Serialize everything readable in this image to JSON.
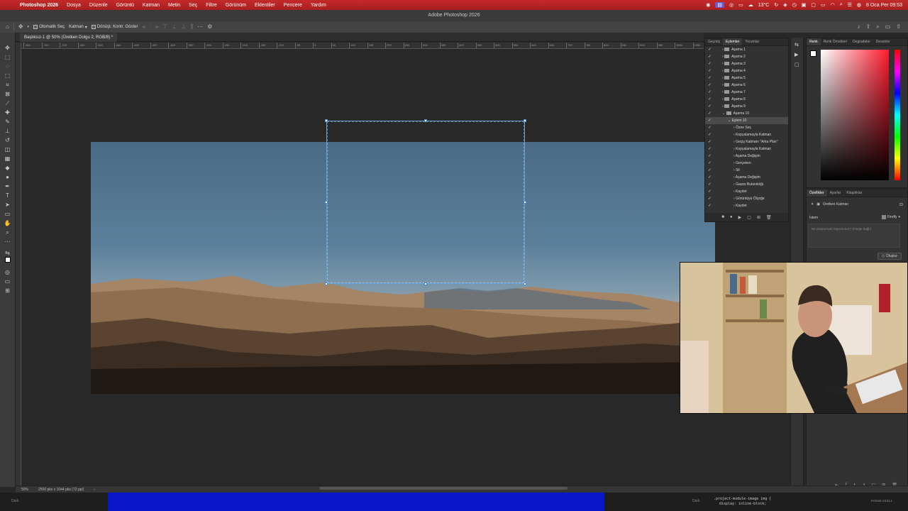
{
  "menubar": {
    "items": [
      "Photoshop 2026",
      "Dosya",
      "Düzenle",
      "Görüntü",
      "Katman",
      "Metin",
      "Seç",
      "Filtre",
      "Görünüm",
      "Eklentiler",
      "Pencere",
      "Yardım"
    ],
    "weather": "13°C",
    "datetime": "8 Oca Per 09:53"
  },
  "window": {
    "title": "Adobe Photoshop 2026"
  },
  "options": {
    "auto_select_label": "Otomatik Seç",
    "layer_select": "Katman",
    "transform_controls_label": "Dönüşt. Kontr. Göster"
  },
  "document": {
    "tab_label": "Başlıksız-1 @ 50% (Üretken Dolgu 2, RGB/8) *"
  },
  "ruler": {
    "labels": [
      "-800",
      "-750",
      "-700",
      "-650",
      "-600",
      "-550",
      "-500",
      "-450",
      "-400",
      "-350",
      "-300",
      "-250",
      "-200",
      "-150",
      "-100",
      "-50",
      "0",
      "50",
      "100",
      "150",
      "200",
      "250",
      "300",
      "350",
      "400",
      "450",
      "500",
      "550",
      "600",
      "650",
      "700",
      "750",
      "800",
      "850",
      "900",
      "950",
      "1000",
      "1050",
      "1100",
      "1150",
      "1200",
      "1250",
      "1300",
      "1350",
      "1400",
      "1450",
      "1500",
      "1550"
    ]
  },
  "actions_panel": {
    "tabs": [
      "Geçmiş",
      "Eylemler",
      "Yorumlar"
    ],
    "rows": [
      {
        "label": "Aşama 1",
        "type": "folder"
      },
      {
        "label": "Aşama 2",
        "type": "folder"
      },
      {
        "label": "Aşama 3",
        "type": "folder"
      },
      {
        "label": "Aşama 4",
        "type": "folder"
      },
      {
        "label": "Aşama 5",
        "type": "folder"
      },
      {
        "label": "Aşama 6",
        "type": "folder"
      },
      {
        "label": "Aşama 7",
        "type": "folder"
      },
      {
        "label": "Aşama 8",
        "type": "folder"
      },
      {
        "label": "Aşama 9",
        "type": "folder"
      },
      {
        "label": "Aşama 10",
        "type": "folder-open"
      },
      {
        "label": "Eylem 10",
        "type": "action",
        "selected": true
      },
      {
        "label": "Özne Seç",
        "type": "step"
      },
      {
        "label": "Kopyalamayla Katman",
        "type": "step"
      },
      {
        "label": "Geçiş Katmanı \"Arka Plan\"",
        "type": "step"
      },
      {
        "label": "Kopyalamayla Katman",
        "type": "step"
      },
      {
        "label": "Aşama Değişim",
        "type": "step"
      },
      {
        "label": "Gerçeken",
        "type": "step"
      },
      {
        "label": "Sil",
        "type": "step"
      },
      {
        "label": "Aşama Değişim",
        "type": "step"
      },
      {
        "label": "Gauss Bulanıklığı",
        "type": "step"
      },
      {
        "label": "Kaydet",
        "type": "step"
      },
      {
        "label": "Görüntüyü Ölçeğe",
        "type": "step"
      },
      {
        "label": "Kaydet",
        "type": "step"
      }
    ]
  },
  "color_panel": {
    "tabs": [
      "Renk",
      "Renk Örnekleri",
      "Degradeler",
      "Desenler"
    ],
    "hue_color": "#ff1a2e"
  },
  "properties_panel": {
    "tabs": [
      "Özellikler",
      "Ayarlar",
      "Kitaplıklar"
    ],
    "layer_type": "Üretken Katman",
    "prompt_label": "İstem",
    "model_select": "Firefly",
    "prompt_placeholder": "Ne oluşturmak istiyorsunuz? (İsteğe bağlı)",
    "generate_button": "Oluştur"
  },
  "status": {
    "zoom": "50%",
    "doc_size": "2500 pks x 1044 pks (72 ppi)"
  },
  "taskbar": {
    "left_label": "Dark",
    "right_label": "Dark",
    "code_snippet": ".project-module-image img {",
    "code_snippet2": "display: inline-block;",
    "right_status": "POSIXE CSS3.1"
  }
}
